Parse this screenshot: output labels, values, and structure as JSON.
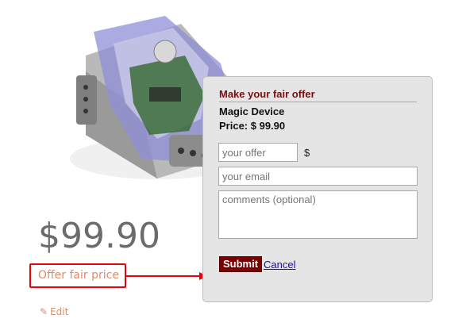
{
  "product": {
    "price_display": "$99.90",
    "offer_link_label": "Offer fair price",
    "edit_label": "Edit"
  },
  "dialog": {
    "title": "Make your fair offer",
    "product_name": "Magic Device",
    "product_price": "Price: $ 99.90",
    "offer_placeholder": "your offer",
    "currency_symbol": "$",
    "email_placeholder": "your email",
    "comments_placeholder": "comments (optional)",
    "submit_label": "Submit",
    "cancel_label": "Cancel"
  },
  "colors": {
    "callout_red": "#e8000b",
    "dialog_title": "#7a1010",
    "submit_bg": "#7b0000",
    "link_orange": "#e08a6a"
  },
  "icons": {
    "edit": "pencil-icon",
    "callout": "arrow-right-icon"
  }
}
